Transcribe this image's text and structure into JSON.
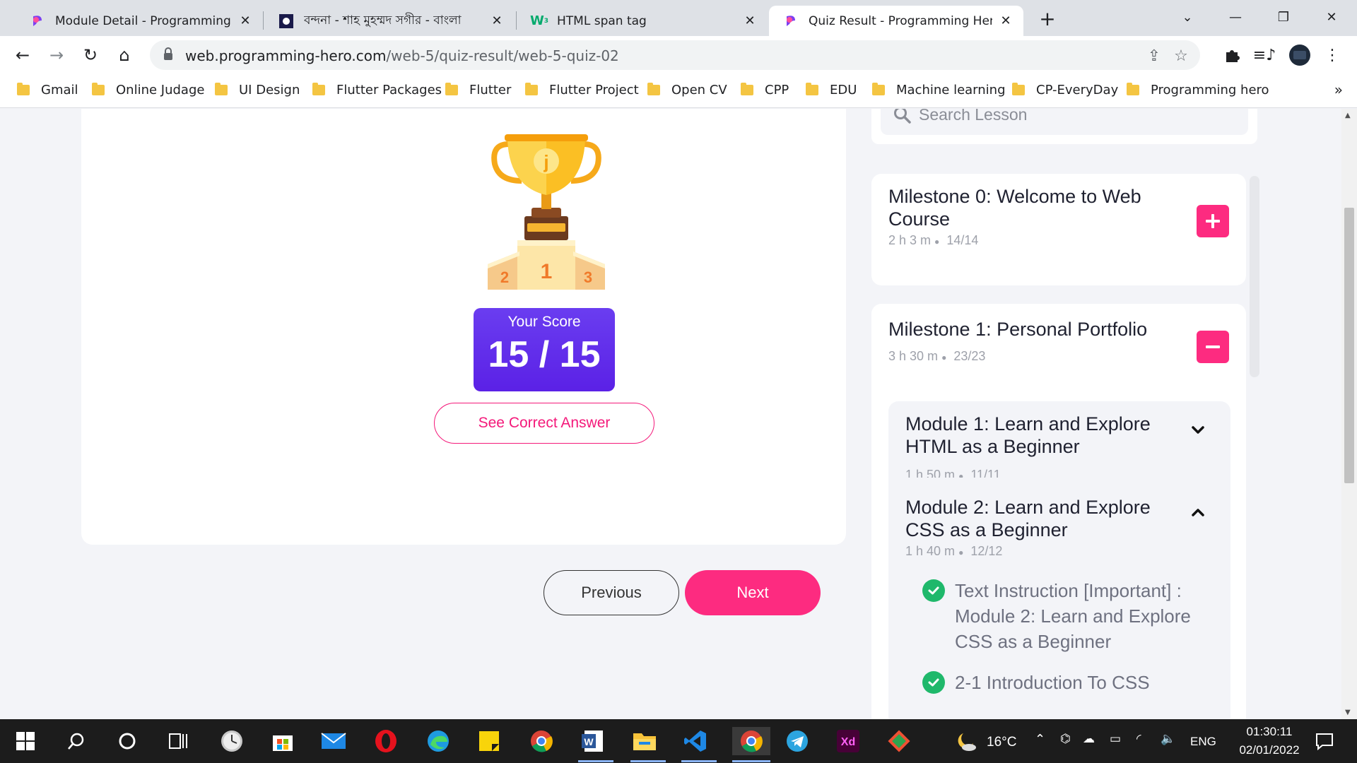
{
  "browser": {
    "tabs": [
      {
        "title": "Module Detail - Programming Hero",
        "active": false
      },
      {
        "title": "বন্দনা - শাহ মুহম্মদ সগীর - বাংলা",
        "active": false
      },
      {
        "title": "HTML span tag",
        "active": false
      },
      {
        "title": "Quiz Result - Programming Hero",
        "active": true
      }
    ],
    "url_host": "web.programming-hero.com",
    "url_path": "/web-5/quiz-result/web-5-quiz-02",
    "bookmarks": [
      "Gmail",
      "Online Judage",
      "UI Design",
      "Flutter Packages",
      "Flutter",
      "Flutter Project",
      "Open CV",
      "CPP",
      "EDU",
      "Machine learning",
      "CP-EveryDay",
      "Programming hero"
    ],
    "more_bookmarks": "»"
  },
  "quiz": {
    "score_label": "Your Score",
    "score_value": "15 / 15",
    "see_answer_label": "See Correct Answer",
    "previous_label": "Previous",
    "next_label": "Next"
  },
  "sidebar": {
    "search_placeholder": "Search Lesson",
    "milestones": [
      {
        "title": "Milestone 0: Welcome to Web Course",
        "duration": "2 h 3 m",
        "progress": "14/14",
        "expanded": false
      },
      {
        "title": "Milestone 1: Personal Portfolio",
        "duration": "3 h 30 m",
        "progress": "23/23",
        "expanded": true
      }
    ],
    "modules": [
      {
        "title": "Module 1: Learn and Explore HTML as a Beginner",
        "duration": "1 h 50 m",
        "progress": "11/11",
        "expanded": false
      },
      {
        "title": "Module 2: Learn and Explore CSS as a Beginner",
        "duration": "1 h 40 m",
        "progress": "12/12",
        "expanded": true
      }
    ],
    "lessons": [
      {
        "title": "Text Instruction [Important] : Module 2: Learn and Explore CSS as a Beginner",
        "completed": true
      },
      {
        "title": "2-1 Introduction To CSS",
        "completed": true
      }
    ]
  },
  "taskbar": {
    "weather_temp": "16°C",
    "language": "ENG",
    "time": "01:30:11",
    "date": "02/01/2022"
  },
  "colors": {
    "accent_pink": "#fd2b80",
    "score_purple": "#5b21e6",
    "success_green": "#1fb86b"
  }
}
